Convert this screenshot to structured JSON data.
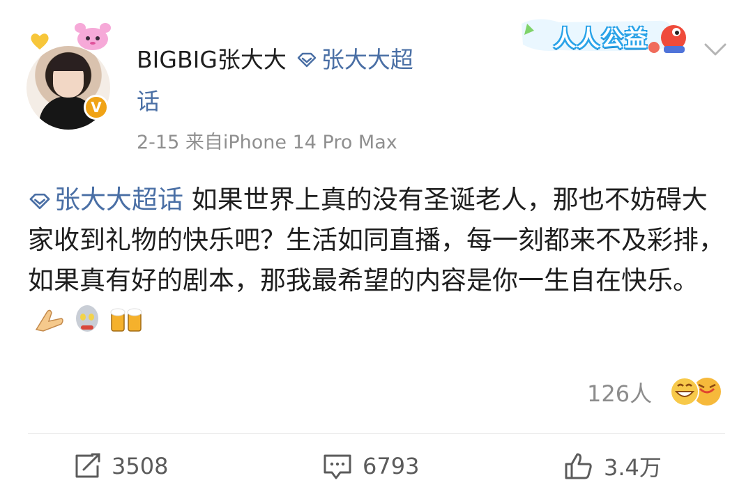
{
  "post": {
    "username": "BIGBIG张大大",
    "topic_line1": "张大大超",
    "topic_line2": "话",
    "meta": "2-15  来自iPhone 14 Pro Max",
    "badge_label": "人人公益",
    "content_tag": "张大大超话",
    "content_text": " 如果世界上真的没有圣诞老人，那也不妨碍大家收到礼物的快乐吧？生活如同直播，每一刻都来不及彩排，如果真有好的剧本，那我最希望的内容是你一生自在快乐。",
    "reaction_count": "126人",
    "verified_badge": "V"
  },
  "actions": {
    "share": "3508",
    "comment": "6793",
    "like": "3.4万"
  },
  "icons": {
    "topic": "diamond-icon",
    "chevron": "chevron-down-icon",
    "share": "share-icon",
    "comment": "comment-icon",
    "like": "thumbs-up-icon"
  },
  "colors": {
    "link": "#4a6fa5",
    "meta": "#8f8f8f",
    "verified": "#f0a316"
  }
}
